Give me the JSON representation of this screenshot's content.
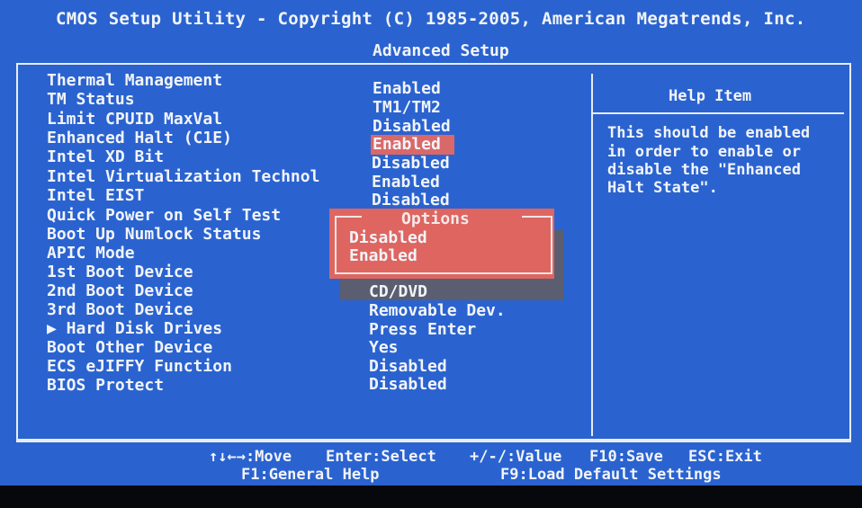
{
  "header": {
    "title": "CMOS Setup Utility - Copyright (C) 1985-2005, American Megatrends, Inc.",
    "subtitle": "Advanced Setup"
  },
  "settings": [
    {
      "label": "Thermal Management",
      "value": "Enabled"
    },
    {
      "label": "TM Status",
      "value": "TM1/TM2"
    },
    {
      "label": "Limit CPUID MaxVal",
      "value": "Disabled"
    },
    {
      "label": "Enhanced Halt (C1E)",
      "value": "Enabled"
    },
    {
      "label": "Intel XD Bit",
      "value": "Disabled"
    },
    {
      "label": "Intel Virtualization Technol",
      "value": "Enabled"
    },
    {
      "label": "Intel EIST",
      "value": "Disabled"
    },
    {
      "label": "Quick Power on Self Test",
      "value": ""
    },
    {
      "label": "Boot Up Numlock Status",
      "value": ""
    },
    {
      "label": "APIC Mode",
      "value": ""
    },
    {
      "label": "1st Boot Device",
      "value": ""
    },
    {
      "label": "2nd Boot Device",
      "value": "CD/DVD"
    },
    {
      "label": "3rd Boot Device",
      "value": "Removable Dev."
    },
    {
      "label": "▶ Hard Disk Drives",
      "value": "Press Enter"
    },
    {
      "label": "Boot Other Device",
      "value": "Yes"
    },
    {
      "label": "ECS eJIFFY Function",
      "value": "Disabled"
    },
    {
      "label": "BIOS Protect",
      "value": "Disabled"
    }
  ],
  "popup": {
    "title": "Options",
    "options": [
      "Disabled",
      "Enabled"
    ],
    "selected": "Enabled"
  },
  "help": {
    "title": "Help Item",
    "lines": [
      "This should be enabled",
      "in order to enable or",
      "disable the \"Enhanced",
      "Halt State\"."
    ]
  },
  "footer": {
    "move": "↑↓←→:Move",
    "select": "Enter:Select",
    "value": "+/-/:Value",
    "save": "F10:Save",
    "exit": "ESC:Exit",
    "general_help": "F1:General Help",
    "load_defaults": "F9:Load Default Settings"
  },
  "colors": {
    "background": "#2a63d0",
    "text": "#f2f4f8",
    "highlight": "#d96868",
    "popup": "#de6560"
  }
}
